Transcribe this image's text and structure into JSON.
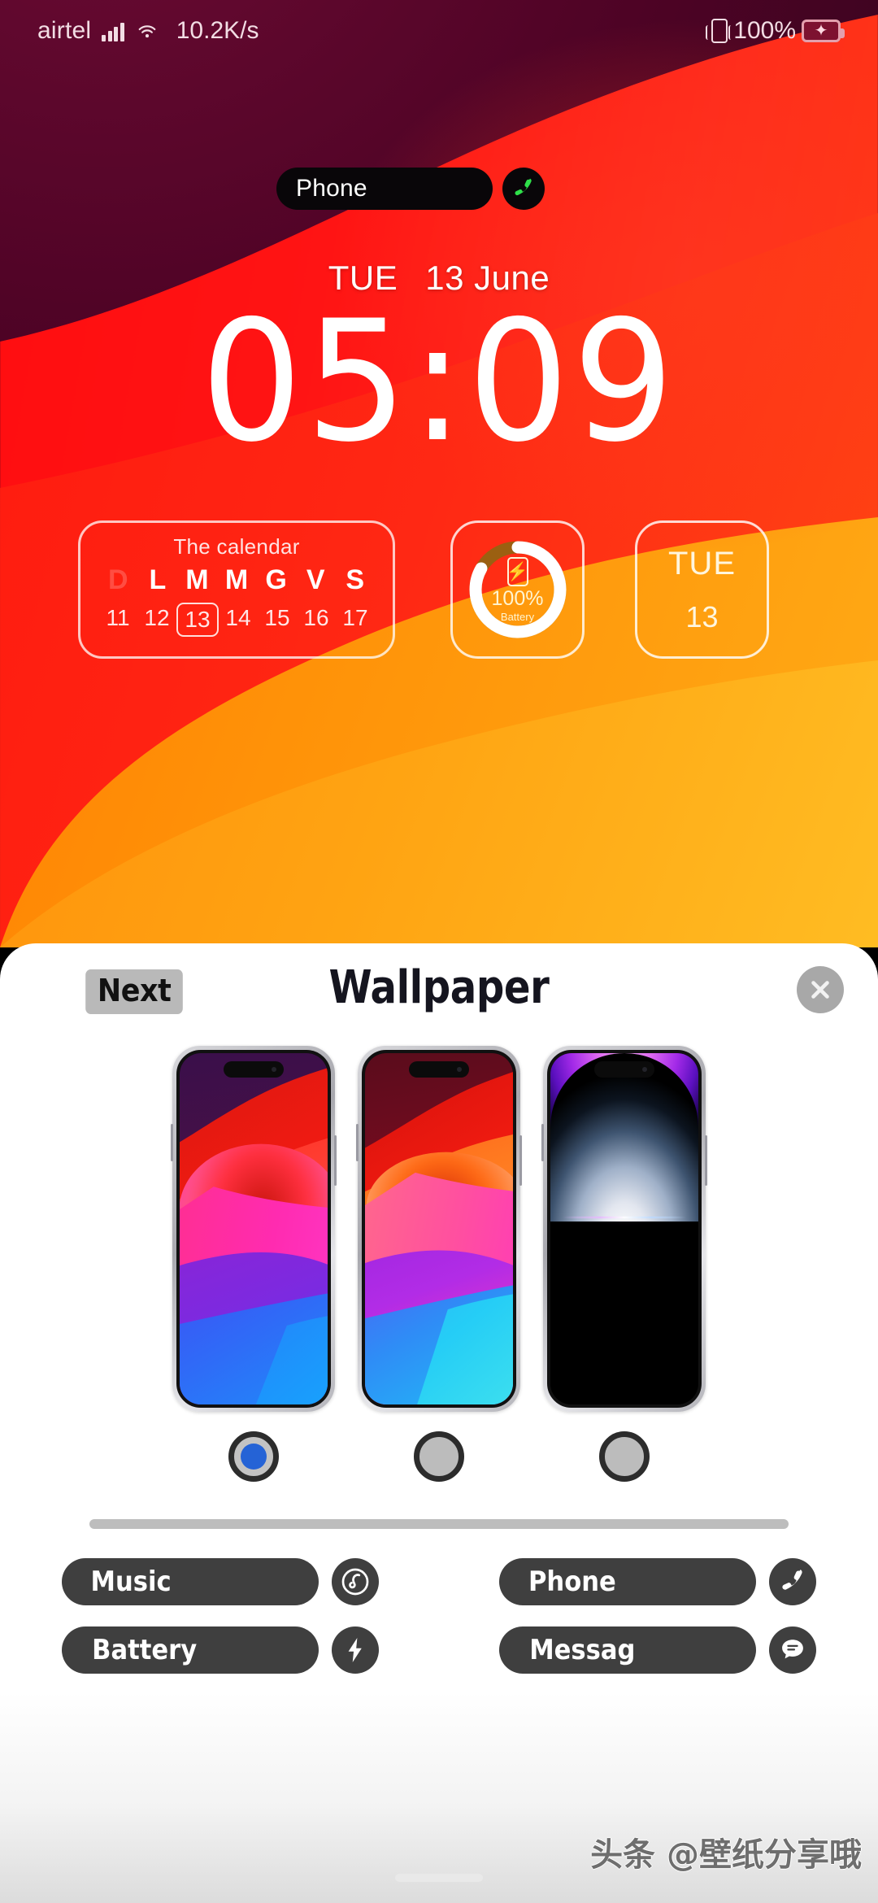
{
  "status_bar": {
    "carrier": "airtel",
    "network_speed": "10.2K/s",
    "battery_percent": "100%",
    "signal_icon": "signal-bars-icon",
    "wifi_icon": "wifi-icon",
    "vibrate_icon": "vibrate-icon",
    "battery_icon": "battery-charging-icon"
  },
  "lockscreen": {
    "phone_widget": {
      "label": "Phone",
      "icon": "phone-handset-icon"
    },
    "date": {
      "weekday": "TUE",
      "day_month": "13 June"
    },
    "clock": "05:09",
    "calendar_widget": {
      "title": "The calendar",
      "dow": [
        "D",
        "L",
        "M",
        "M",
        "G",
        "V",
        "S"
      ],
      "days": [
        "11",
        "12",
        "13",
        "14",
        "15",
        "16",
        "17"
      ],
      "today": "13"
    },
    "battery_widget": {
      "percent": "100%",
      "label": "Battery",
      "progress": 100,
      "icon": "phone-charging-icon"
    },
    "date_widget": {
      "weekday": "TUE",
      "day": "13"
    }
  },
  "sheet": {
    "next_label": "Next",
    "title": "Wallpaper",
    "close_icon": "close-icon",
    "previews": [
      {
        "name": "wallpaper-preview-1",
        "selected": true
      },
      {
        "name": "wallpaper-preview-2",
        "selected": false
      },
      {
        "name": "wallpaper-preview-3",
        "selected": false
      }
    ],
    "shortcuts": [
      {
        "label": "Music",
        "icon": "music-spiral-icon"
      },
      {
        "label": "Phone",
        "icon": "phone-handset-icon"
      },
      {
        "label": "Battery",
        "icon": "lightning-bolt-icon"
      },
      {
        "label": "Messag",
        "icon": "message-bubble-icon"
      }
    ]
  },
  "watermark": "头条 @壁纸分享哦",
  "colors": {
    "accent_blue": "#2563d6",
    "pill_dark": "#3f3f3f",
    "phone_green": "#2fd44a",
    "wallpaper_red": "#ff1414",
    "wallpaper_orange": "#ff9208"
  }
}
